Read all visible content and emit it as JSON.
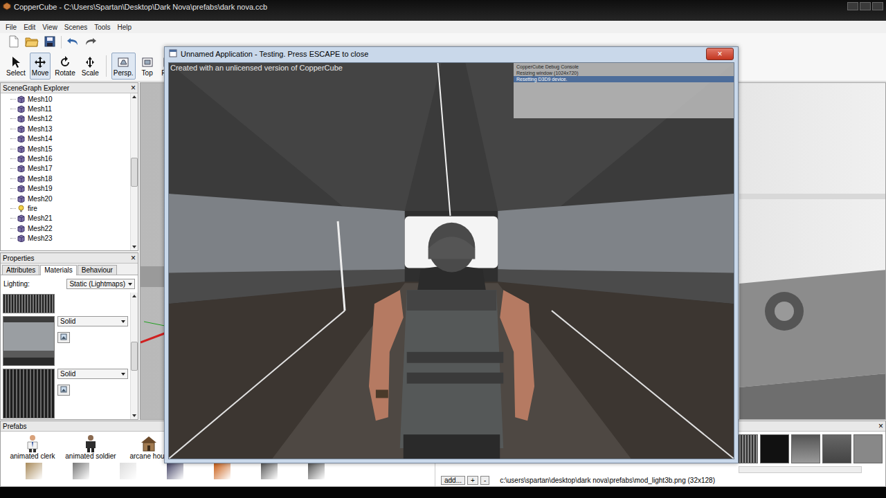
{
  "window": {
    "title": "CopperCube - C:\\Users\\Spartan\\Desktop\\Dark Nova\\prefabs\\dark nova.ccb"
  },
  "menu": [
    "File",
    "Edit",
    "View",
    "Scenes",
    "Tools",
    "Help"
  ],
  "tools": [
    {
      "label": "Select",
      "selected": false
    },
    {
      "label": "Move",
      "selected": true
    },
    {
      "label": "Rotate",
      "selected": false
    },
    {
      "label": "Scale",
      "selected": false
    }
  ],
  "views": [
    {
      "label": "Persp.",
      "selected": true
    },
    {
      "label": "Top",
      "selected": false
    },
    {
      "label": "Fron",
      "selected": false
    }
  ],
  "scene_graph": {
    "title": "SceneGraph Explorer",
    "close": "×",
    "items": [
      {
        "label": "Mesh10",
        "kind": "mesh"
      },
      {
        "label": "Mesh11",
        "kind": "mesh"
      },
      {
        "label": "Mesh12",
        "kind": "mesh"
      },
      {
        "label": "Mesh13",
        "kind": "mesh"
      },
      {
        "label": "Mesh14",
        "kind": "mesh"
      },
      {
        "label": "Mesh15",
        "kind": "mesh"
      },
      {
        "label": "Mesh16",
        "kind": "mesh"
      },
      {
        "label": "Mesh17",
        "kind": "mesh"
      },
      {
        "label": "Mesh18",
        "kind": "mesh"
      },
      {
        "label": "Mesh19",
        "kind": "mesh"
      },
      {
        "label": "Mesh20",
        "kind": "mesh"
      },
      {
        "label": "fire",
        "kind": "light"
      },
      {
        "label": "Mesh21",
        "kind": "mesh"
      },
      {
        "label": "Mesh22",
        "kind": "mesh"
      },
      {
        "label": "Mesh23",
        "kind": "mesh"
      }
    ]
  },
  "properties": {
    "title": "Properties",
    "close": "×",
    "tabs": [
      {
        "label": "Attributes",
        "selected": false
      },
      {
        "label": "Materials",
        "selected": true
      },
      {
        "label": "Behaviour",
        "selected": false
      }
    ],
    "lighting_label": "Lighting:",
    "lighting_value": "Static (Lightmaps)",
    "materials": [
      {
        "mode": "Solid"
      },
      {
        "mode": "Solid"
      }
    ]
  },
  "test_window": {
    "title": "Unnamed Application - Testing. Press ESCAPE to close",
    "close": "×",
    "watermark": "Created with an unlicensed version of CopperCube",
    "debug_console": [
      {
        "text": "CopperCube Debug Console",
        "selected": false
      },
      {
        "text": "Resizing window (1024x720)",
        "selected": false
      },
      {
        "text": "Resetting D3D9 device.",
        "selected": true
      }
    ]
  },
  "prefabs": {
    "title": "Prefabs",
    "close": "×",
    "items": [
      {
        "label": "animated clerk"
      },
      {
        "label": "animated soldier"
      },
      {
        "label": "arcane hous"
      }
    ],
    "add": "add...",
    "plus": "+",
    "minus": "-",
    "path": "c:\\users\\spartan\\desktop\\dark nova\\prefabs\\mod_light3b.png (32x128)"
  }
}
